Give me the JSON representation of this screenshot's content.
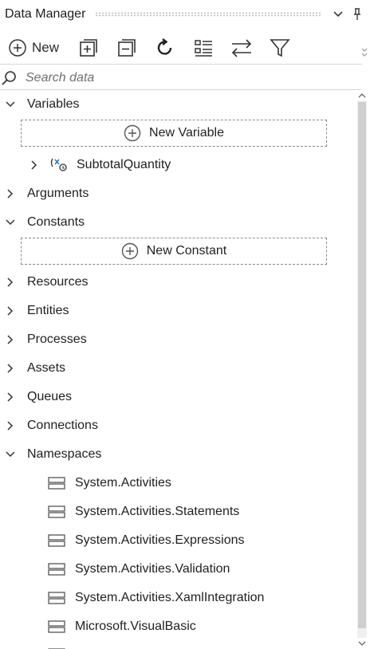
{
  "panel": {
    "title": "Data Manager"
  },
  "toolbar": {
    "new_label": "New"
  },
  "search": {
    "placeholder": "Search data"
  },
  "tree": {
    "variables": {
      "label": "Variables",
      "add_label": "New Variable",
      "items": [
        "SubtotalQuantity"
      ]
    },
    "arguments": {
      "label": "Arguments"
    },
    "constants": {
      "label": "Constants",
      "add_label": "New Constant"
    },
    "resources": {
      "label": "Resources"
    },
    "entities": {
      "label": "Entities"
    },
    "processes": {
      "label": "Processes"
    },
    "assets": {
      "label": "Assets"
    },
    "queues": {
      "label": "Queues"
    },
    "connections": {
      "label": "Connections"
    },
    "namespaces": {
      "label": "Namespaces",
      "items": [
        "System.Activities",
        "System.Activities.Statements",
        "System.Activities.Expressions",
        "System.Activities.Validation",
        "System.Activities.XamlIntegration",
        "Microsoft.VisualBasic"
      ]
    }
  }
}
